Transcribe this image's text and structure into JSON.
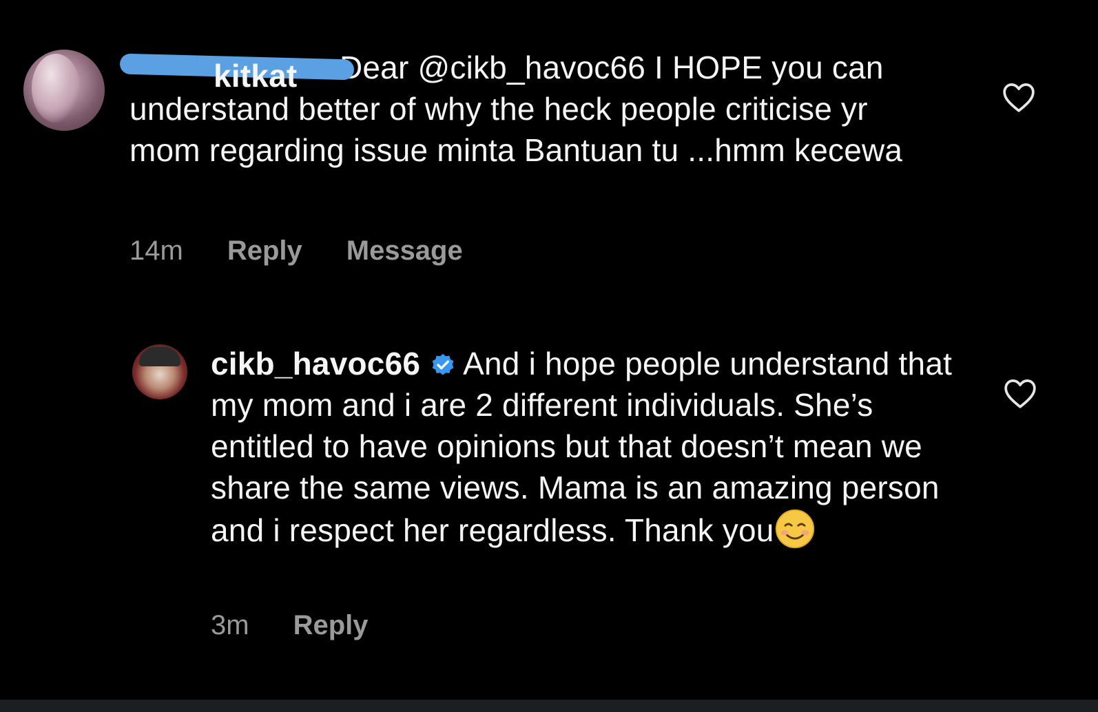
{
  "comments": [
    {
      "username_suffix": "kitkat",
      "text": "Dear @cikb_havoc66 I HOPE you can understand better of why the heck people criticise yr mom regarding issue minta Bantuan tu ...hmm kecewa",
      "time": "14m",
      "reply_label": "Reply",
      "message_label": "Message",
      "like_icon": "heart-outline-icon"
    },
    {
      "username": "cikb_havoc66",
      "verified": true,
      "text": "And i hope people understand that my mom and i are 2 different individuals. She’s entitled to have opinions but that doesn’t mean we share the same views. Mama is an amazing person and i respect her regardless. Thank you",
      "emoji": "smiling-face-emoji",
      "time": "3m",
      "reply_label": "Reply",
      "like_icon": "heart-outline-icon"
    }
  ],
  "colors": {
    "background": "#000000",
    "text": "#f5f5f5",
    "meta": "#9a9a9a",
    "verified_blue": "#3897f0",
    "redaction_marker": "#5aa0e3"
  }
}
